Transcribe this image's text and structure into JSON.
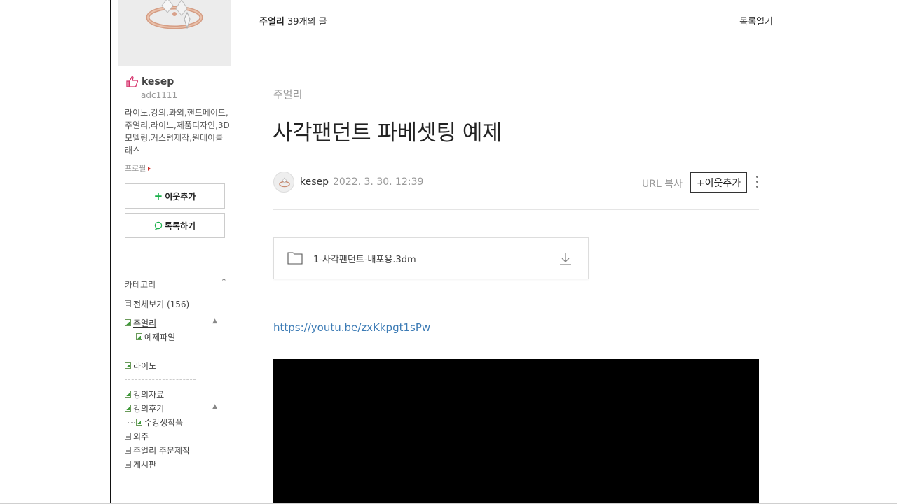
{
  "sidebar": {
    "nickname": "kesep",
    "blog_id": "adc1111",
    "intro": "라이노,강의,과외,핸드메이드,주얼리,라이노,제품디자인,3D모델링,커스텀제작,원데이클래스",
    "profile_link": "프로필",
    "add_neighbor": "이웃추가",
    "talk": "톡톡하기",
    "category_header": "카테고리",
    "categories": [
      {
        "label": "전체보기 (156)",
        "icon": "doc-icon"
      },
      {
        "label": "주얼리",
        "icon": "image-icon",
        "active": true
      },
      {
        "label": "예제파일",
        "icon": "image-icon",
        "sub": true
      },
      {
        "label": "라이노",
        "icon": "image-icon"
      },
      {
        "label": "강의자료",
        "icon": "image-icon"
      },
      {
        "label": "강의후기",
        "icon": "image-icon"
      },
      {
        "label": "수강생작품",
        "icon": "image-icon",
        "sub": true
      },
      {
        "label": "외주",
        "icon": "doc-icon"
      },
      {
        "label": "주얼리 주문제작",
        "icon": "doc-icon"
      },
      {
        "label": "게시판",
        "icon": "doc-icon"
      }
    ]
  },
  "topbar": {
    "category": "주얼리",
    "count": " 39개의 글",
    "open_list": "목록열기"
  },
  "post": {
    "category": "주얼리",
    "title": "사각팬던트 파베셋팅 예제",
    "author": "kesep",
    "date": "2022. 3. 30. 12:39",
    "url_copy": "URL 복사",
    "add_neighbor": "+이웃추가",
    "file_name": "1-사각팬던트-배포용.3dm",
    "video_link": "https://youtu.be/zxKkpgt1sPw"
  },
  "colors": {
    "accent_green": "#1ab04a",
    "link_blue": "#3c7bb5"
  }
}
